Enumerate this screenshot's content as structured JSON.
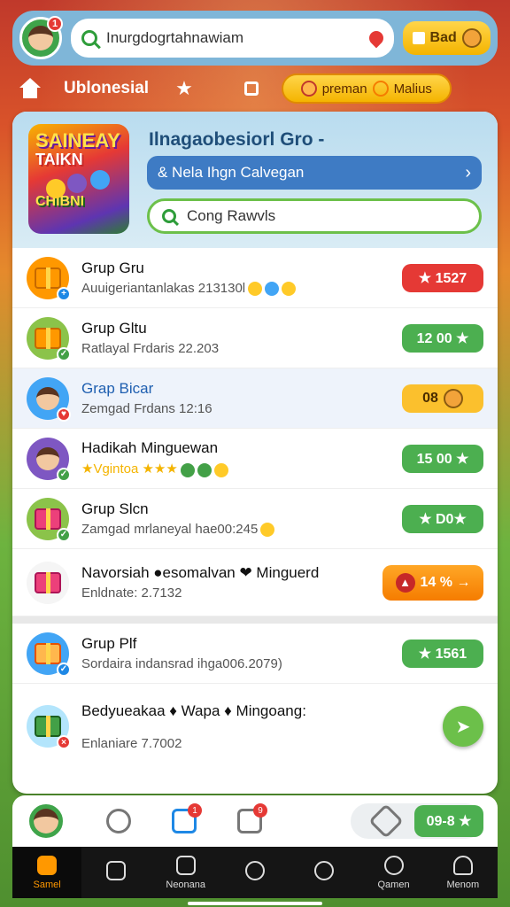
{
  "top": {
    "avatar_badge": "1",
    "search_text": "Inurgdogrtahnawiam",
    "gold_button": "Bad"
  },
  "row2": {
    "title": "Ublonesial",
    "premium_left": "preman",
    "premium_right": "Malius"
  },
  "hero": {
    "logo_lines": [
      "SAINEAY",
      "TAIKN",
      "CHIBNI"
    ],
    "title": "Ilnagaobesiorl Gro -",
    "blue_pill": "& Nela Ihgn Calvegan",
    "green_pill": "Cong Rawvls"
  },
  "items": [
    {
      "title": "Grup Gru",
      "subtitle": "Auuigeriantanlakas 213130l",
      "chip": "★ 1527",
      "chip_color": "red",
      "icon_color": "#ff9800",
      "badge_color": "#1e88e5"
    },
    {
      "title": "Grup Gltu",
      "subtitle": "Ratlayal Frdaris 22.203",
      "chip": "12 00 ★",
      "chip_color": "green",
      "icon_color": "#8bc34a",
      "badge_color": "#43a047"
    },
    {
      "title": "Grap Bicar",
      "subtitle": "Zemgad Frdans 12:16",
      "chip": "08",
      "chip_color": "yellow",
      "icon_color": "#42a5f5",
      "badge_color": "#e53935"
    },
    {
      "title": "Hadikah Minguewan",
      "subtitle": "★Vgintoa ★★★",
      "chip": "15 00 ★",
      "chip_color": "green",
      "icon_color": "#7e57c2",
      "badge_color": "#43a047"
    },
    {
      "title": "Grup Slcn",
      "subtitle": "Zamgad mrlaneyal hae00:245",
      "chip": "★ D0★",
      "chip_color": "green",
      "icon_color": "#8bc34a",
      "badge_color": "#43a047"
    },
    {
      "title": "Navorsiah ●esomalvan ❤ Minguerd",
      "subtitle": "Enldnate: 2.7132",
      "chip": "14 % →",
      "chip_color": "orange",
      "icon_color": "#f5f5f5",
      "badge_color": ""
    },
    {
      "title": "Grup Plf",
      "subtitle": "Sordaira indansrad ihga006.2079)",
      "chip": "★ 1561",
      "chip_color": "green",
      "icon_color": "#42a5f5",
      "badge_color": "#1e88e5"
    },
    {
      "title": "Bedyueakaa ♦ Wapa ♦ Mingoang:",
      "subtitle": "Enlaniare 7.7002",
      "chip": "",
      "chip_color": "",
      "icon_color": "#b3e5fc",
      "badge_color": "#e53935"
    }
  ],
  "actions": {
    "badge1": "1",
    "badge2": "9",
    "pill_chip": "09-8 ★"
  },
  "nav": [
    {
      "label": "Samel",
      "active": true
    },
    {
      "label": "",
      "active": false
    },
    {
      "label": "Neonana",
      "active": false
    },
    {
      "label": "",
      "active": false
    },
    {
      "label": "",
      "active": false
    },
    {
      "label": "Qamen",
      "active": false
    },
    {
      "label": "Menom",
      "active": false
    }
  ]
}
